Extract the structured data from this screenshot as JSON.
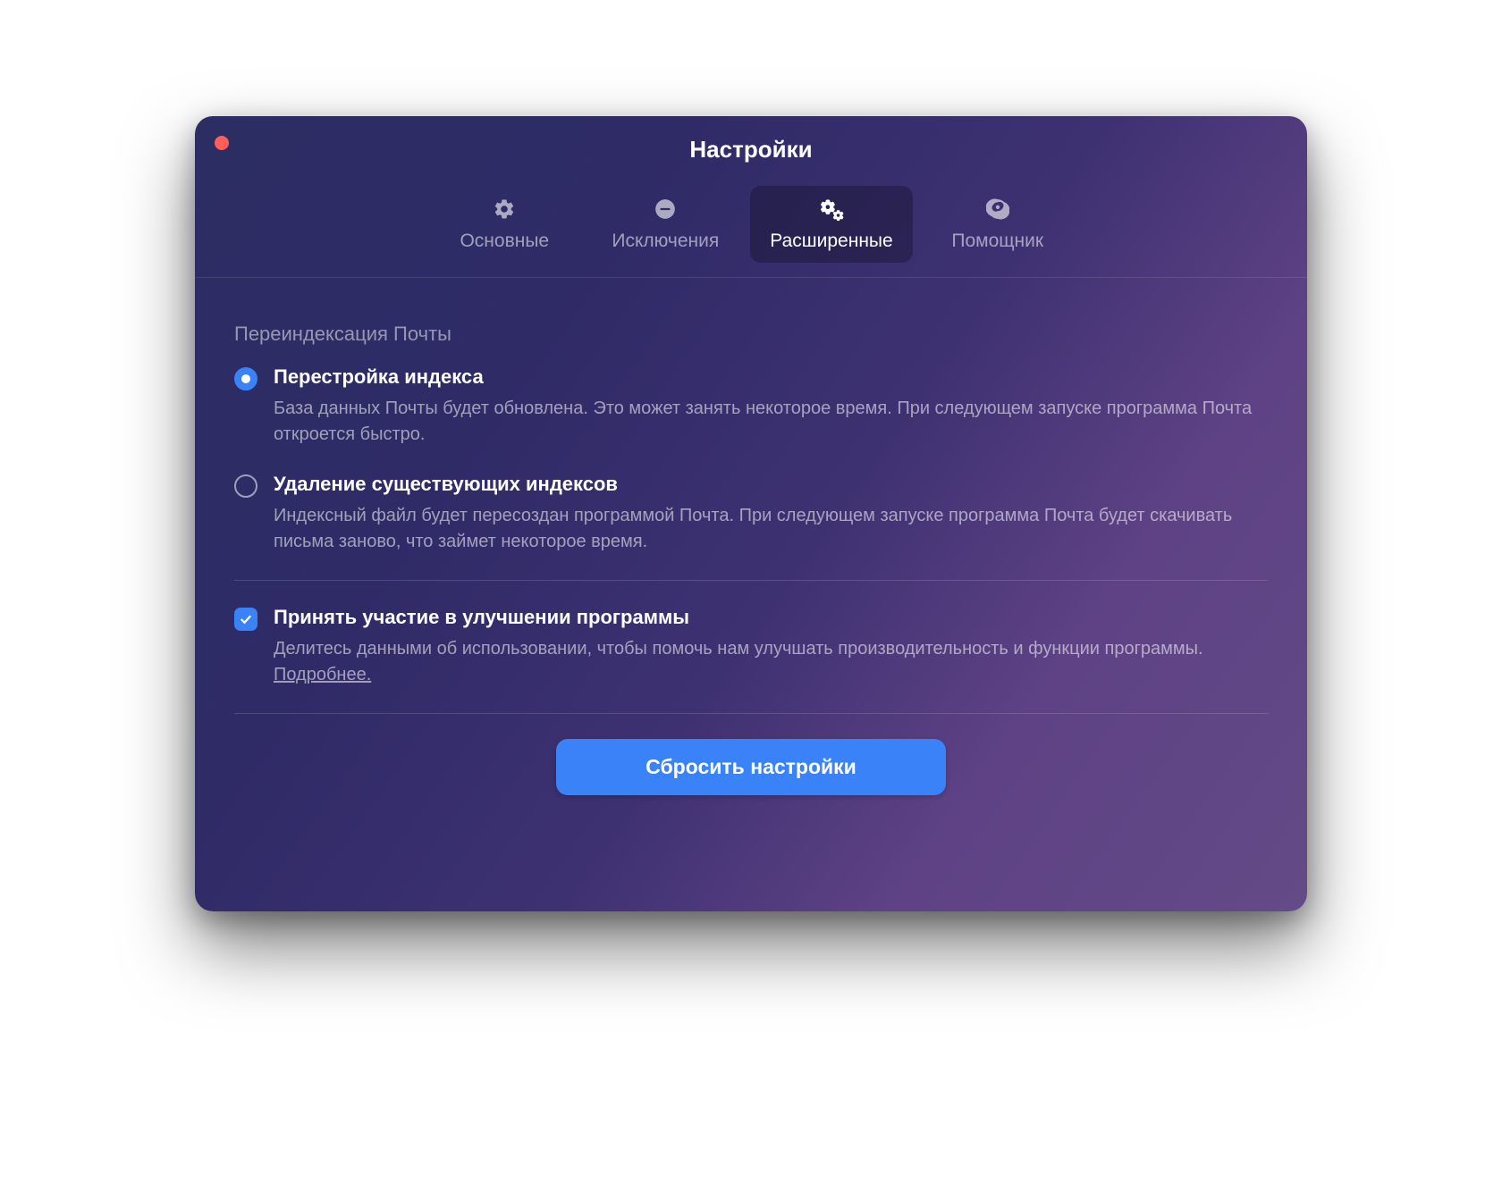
{
  "window": {
    "title": "Настройки"
  },
  "tabs": {
    "general": "Основные",
    "exclusions": "Исключения",
    "advanced": "Расширенные",
    "assistant": "Помощник",
    "active": "advanced"
  },
  "reindex": {
    "header": "Переиндексация Почты",
    "option1": {
      "title": "Перестройка индекса",
      "desc": "База данных Почты будет обновлена. Это может занять некоторое время. При следующем запуске программа Почта откроется быстро.",
      "selected": true
    },
    "option2": {
      "title": "Удаление существующих индексов",
      "desc": "Индексный файл будет пересоздан программой Почта. При следующем запуске программа Почта будет скачивать письма заново, что займет некоторое время.",
      "selected": false
    }
  },
  "improve": {
    "title": "Принять участие в улучшении программы",
    "desc_pre": "Делитесь данными об использовании, чтобы помочь нам улучшать производительность и функции программы. ",
    "link": "Подробнее.",
    "checked": true
  },
  "footer": {
    "reset": "Сбросить настройки"
  }
}
